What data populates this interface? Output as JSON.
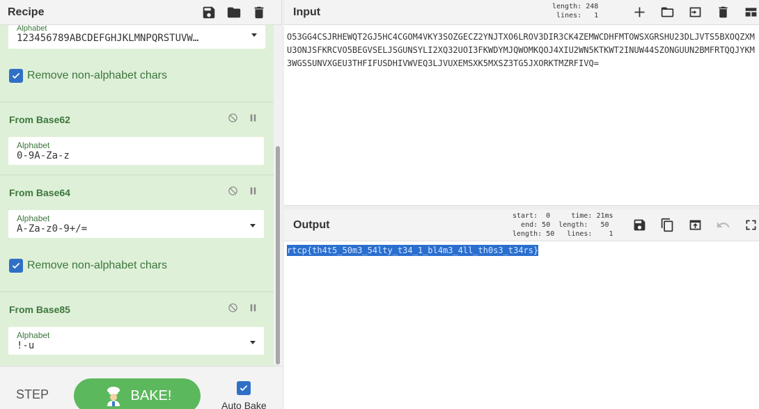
{
  "recipe": {
    "title": "Recipe",
    "ops": [
      {
        "alphabet_value": "123456789ABCDEFGHJKLMNPQRSTUVW…",
        "alphabet_label": "Alphabet",
        "checkbox_label": "Remove non-alphabet chars"
      },
      {
        "title": "From Base62",
        "alphabet_label": "Alphabet",
        "alphabet_value": "0-9A-Za-z"
      },
      {
        "title": "From Base64",
        "alphabet_label": "Alphabet",
        "alphabet_value": "A-Za-z0-9+/=",
        "checkbox_label": "Remove non-alphabet chars"
      },
      {
        "title": "From Base85",
        "alphabet_label": "Alphabet",
        "alphabet_value": "!-u"
      }
    ]
  },
  "controls": {
    "step_label": "STEP",
    "bake_label": "BAKE!",
    "autobake_label": "Auto Bake"
  },
  "input": {
    "title": "Input",
    "stats": {
      "length_label": "length:",
      "length": "248",
      "lines_label": "lines:",
      "lines": "1"
    },
    "text": "O53GG4CSJRHEWQT2GJ5HC4CGOM4VKY3SOZGECZ2YNJTXO6LROV3DIR3CK4ZEMWCDHFMTOWSXGRSHU23DLJVTS5BXOQZXMU3ONJSFKRCVO5BEGVSELJSGUNSYLI2XQ32UOI3FKWDYMJQWOMKQOJ4XIU2WN5KTKWT2INUW44SZONGUUN2BMFRTQQJYKM3WGSSUNVXGEU3THFIFUSDHIVWVEQ3LJVUXEMSXK5MXSZ3TG5JXORKTMZRFIVQ="
  },
  "output": {
    "title": "Output",
    "stats": {
      "start_label": "start:",
      "start": "0",
      "end_label": "end:",
      "end": "50",
      "length_label": "length:",
      "length": "50",
      "time_label": "time:",
      "time": "21ms",
      "length2_label": "length:",
      "length2": "50",
      "lines_label": "lines:",
      "lines": "1"
    },
    "text": "rtcp{th4t5_50m3_54lty_t34_1_bl4m3_4ll_th0s3_t34rs}"
  },
  "colors": {
    "accent": "#2f70c6",
    "op_bg": "#dff0d8",
    "op_text": "#3c763d",
    "bake": "#5cb85c"
  }
}
